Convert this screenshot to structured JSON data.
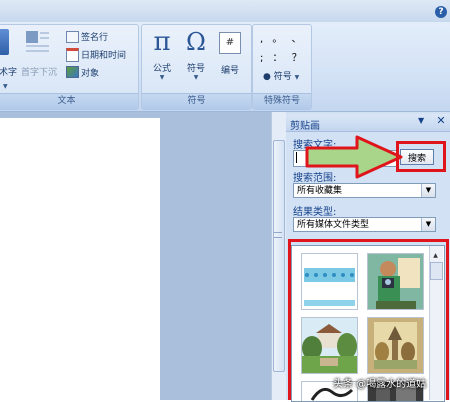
{
  "ribbon": {
    "help_label": "?",
    "text_group": {
      "label": "文本",
      "wordart_label": "术字",
      "dropcap_label": "首字下沉",
      "signature_label": "签名行",
      "datetime_label": "日期和时间",
      "object_label": "对象"
    },
    "symbols_group": {
      "label": "符号",
      "equation_label": "公式",
      "symbol_label": "符号",
      "number_label": "编号",
      "pi_glyph": "π",
      "omega_glyph": "Ω",
      "number_glyph": "#"
    },
    "special_group": {
      "label": "特殊符号",
      "row1": ", 。 、",
      "row2": "; ： ？",
      "symbol_label": "符号"
    }
  },
  "pane": {
    "title": "剪贴画",
    "search_text_label": "搜索文字:",
    "search_value": "",
    "search_button": "搜索",
    "scope_label": "搜索范围:",
    "scope_value": "所有收藏集",
    "type_label": "结果类型:",
    "type_value": "所有媒体文件类型"
  },
  "icons": [
    "wordart-icon",
    "dropcap-icon",
    "signature-icon",
    "datetime-icon",
    "object-icon",
    "equation-icon",
    "symbol-icon",
    "number-icon",
    "close-icon",
    "pane-menu-icon",
    "arrow-annotation-icon"
  ],
  "colors": {
    "highlight": "#e0151b",
    "arrow_fill": "#a8d58a",
    "ribbon": "#d3e2f5"
  },
  "watermark": "头条 @喝露水的道姑"
}
